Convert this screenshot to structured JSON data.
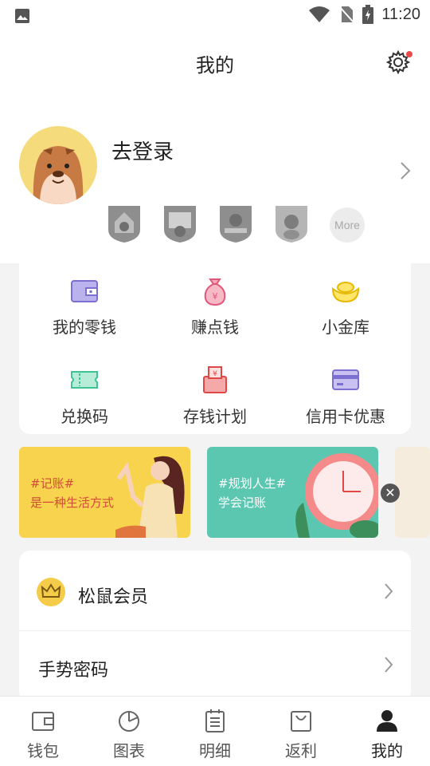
{
  "status_bar": {
    "time": "11:20"
  },
  "header": {
    "title": "我的"
  },
  "profile": {
    "login_label": "去登录",
    "more_label": "More"
  },
  "grid": [
    {
      "label": "我的零钱",
      "icon": "wallet-icon"
    },
    {
      "label": "赚点钱",
      "icon": "money-bag-icon"
    },
    {
      "label": "小金库",
      "icon": "gold-ingot-icon"
    },
    {
      "label": "兑换码",
      "icon": "ticket-icon"
    },
    {
      "label": "存钱计划",
      "icon": "savings-box-icon"
    },
    {
      "label": "信用卡优惠",
      "icon": "credit-card-icon"
    }
  ],
  "banners": [
    {
      "line1": "#记账#",
      "line2": "是一种生活方式"
    },
    {
      "line1": "#规划人生#",
      "line2": "学会记账"
    }
  ],
  "menu": {
    "vip": "松鼠会员",
    "gesture": "手势密码"
  },
  "tabs": [
    {
      "label": "钱包"
    },
    {
      "label": "图表"
    },
    {
      "label": "明细"
    },
    {
      "label": "返利"
    },
    {
      "label": "我的"
    }
  ],
  "colors": {
    "accent": "#f5cc4a",
    "notify_dot": "#e94a4a",
    "banner_yellow": "#f8d34d",
    "banner_green": "#5bc7b0"
  }
}
